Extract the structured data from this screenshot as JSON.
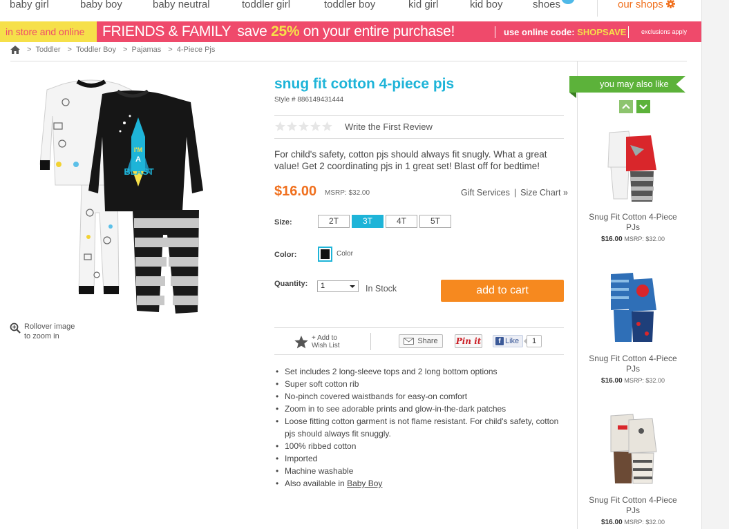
{
  "nav": {
    "items": [
      "baby girl",
      "baby boy",
      "baby neutral",
      "toddler girl",
      "toddler boy",
      "kid girl",
      "kid boy",
      "shoes"
    ],
    "our_shops": "our shops"
  },
  "promo": {
    "in_store": "in store and online",
    "friends_family": "FRIENDS & FAMILY",
    "save": "save",
    "percent": "25%",
    "rest": "on your entire purchase!",
    "code_label": "use online code:",
    "code_value": "SHOPSAVE",
    "exclusions": "exclusions apply"
  },
  "breadcrumb": [
    "Toddler",
    "Toddler Boy",
    "Pajamas",
    "4-Piece Pjs"
  ],
  "product": {
    "title": "snug fit cotton 4-piece pjs",
    "style": "Style # 886149431444",
    "review_link": "Write the First Review",
    "rating": 0,
    "description": "For child's safety, cotton pjs should always fit snugly. What a great value! Get 2 coordinating pjs in 1 great set! Blast off for bedtime!",
    "price": "$16.00",
    "msrp": "MSRP: $32.00",
    "gift_services": "Gift Services",
    "size_chart": "Size Chart »",
    "size_label": "Size:",
    "sizes": [
      "2T",
      "3T",
      "4T",
      "5T"
    ],
    "selected_size": "3T",
    "color_label": "Color:",
    "color_name": "Color",
    "quantity_label": "Quantity:",
    "quantity_value": "1",
    "stock": "In Stock",
    "add_to_cart": "add to cart",
    "zoom_hint": "Rollover image to zoom in",
    "shirt_print": "I'M A BLAST"
  },
  "social": {
    "wish_list": "+ Add to Wish List",
    "share": "Share",
    "pin": "Pin it",
    "like": "Like",
    "like_count": "1"
  },
  "features": [
    "Set includes 2 long-sleeve tops and 2 long bottom options",
    "Super soft cotton rib",
    "No-pinch covered waistbands for easy-on comfort",
    "Zoom in to see adorable prints and glow-in-the-dark patches",
    "Loose fitting cotton garment is not flame resistant. For child's safety, cotton pjs should always fit snuggly.",
    "100% ribbed cotton",
    "Imported",
    "Machine washable"
  ],
  "also_available": {
    "prefix": "Also available in",
    "link": "Baby Boy"
  },
  "recommendations": {
    "title": "you may also like",
    "items": [
      {
        "name": "Snug Fit Cotton 4-Piece PJs",
        "price": "$16.00",
        "msrp": "MSRP: $32.00",
        "top_color": "#d9262b",
        "pant_color": "#555555"
      },
      {
        "name": "Snug Fit Cotton 4-Piece PJs",
        "price": "$16.00",
        "msrp": "MSRP: $32.00",
        "top_color": "#2f6fb7",
        "pant_color": "#1e3f7a"
      },
      {
        "name": "Snug Fit Cotton 4-Piece PJs",
        "price": "$16.00",
        "msrp": "MSRP: $32.00",
        "top_color": "#e8e4dc",
        "pant_color": "#6b4a35"
      }
    ]
  },
  "colors": {
    "accent_blue": "#1eb4d8",
    "orange": "#f0701e",
    "cart_orange": "#f6891f",
    "promo_pink": "#ef4a6b",
    "promo_yellow": "#f6e04a",
    "green": "#5cb23a"
  }
}
